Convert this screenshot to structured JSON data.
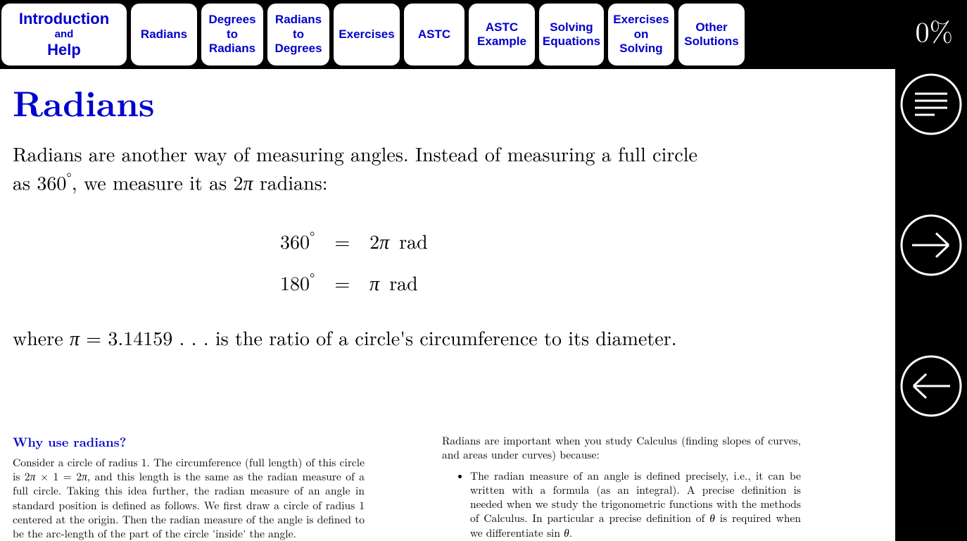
{
  "percent": "0%",
  "tabs": {
    "intro_line1": "Introduction",
    "intro_line2": "and",
    "intro_line3": "Help",
    "radians": "Radians",
    "deg1": "Degrees",
    "deg2": "to",
    "deg3": "Radians",
    "rad1": "Radians",
    "rad2": "to",
    "rad3": "Degrees",
    "exercises": "Exercises",
    "astc": "ASTC",
    "astcex1": "ASTC",
    "astcex2": "Example",
    "solving1": "Solving",
    "solving2": "Equations",
    "exsol1": "Exercises",
    "exsol2": "on",
    "exsol3": "Solving",
    "other1": "Other",
    "other2": "Solutions"
  },
  "page": {
    "title": "Radians",
    "intro": "Radians are another way of measuring angles. Instead of measuring a full circle as 360°, we measure it as 2π radians:",
    "eq1_left": "360°",
    "eq_eq": "=",
    "eq1_right": "2π rad",
    "eq2_left": "180°",
    "eq2_right": "π rad",
    "where": "where π = 3.14159 . . . is the ratio of a circle's circumference to its diameter."
  },
  "footer": {
    "heading": "Why use radians?",
    "left_para": "Consider a circle of radius 1. The circumference (full length) of this circle is 2π × 1 = 2π, and this length is the same as the radian measure of a full circle. Taking this idea further, the radian measure of an angle in standard position is defined as follows. We first draw a circle of radius 1 centered at the origin. Then the radian measure of the angle is defined to be the arc-length of the part of the circle 'inside' the angle.",
    "right_intro": "Radians are important when you study Calculus (finding slopes of curves, and areas under curves) because:",
    "right_bullet": "The radian measure of an angle is defined precisely, i.e., it can be written with a formula (as an integral). A precise definition is needed when we study the trigonometric functions with the methods of Calculus. In particular a precise definition of θ is required when we differentiate sin θ."
  }
}
